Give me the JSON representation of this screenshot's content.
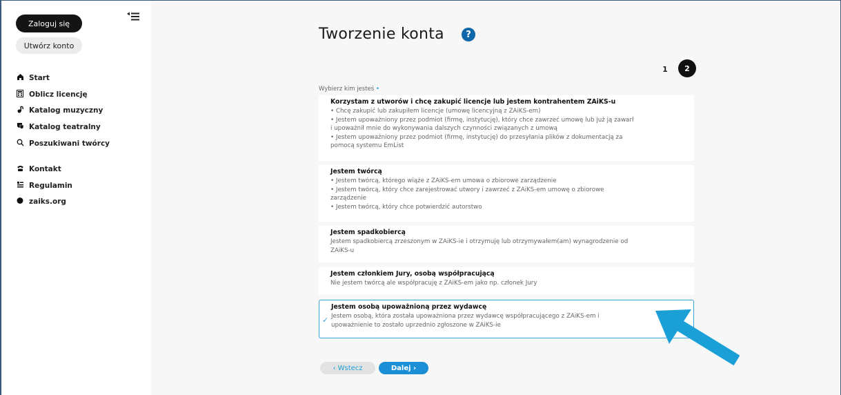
{
  "sidebar": {
    "login_label": "Zaloguj się",
    "register_label": "Utwórz konto",
    "collapse_icon": "collapse-sidebar-icon",
    "nav_primary": [
      {
        "label": "Start",
        "icon": "home-icon"
      },
      {
        "label": "Oblicz licencję",
        "icon": "calculator-icon"
      },
      {
        "label": "Katalog muzyczny",
        "icon": "music-icon"
      },
      {
        "label": "Katalog teatralny",
        "icon": "theater-icon"
      },
      {
        "label": "Poszukiwani twórcy",
        "icon": "search-icon"
      }
    ],
    "nav_secondary": [
      {
        "label": "Kontakt",
        "icon": "phone-icon"
      },
      {
        "label": "Regulamin",
        "icon": "document-icon"
      },
      {
        "label": "zaiks.org",
        "icon": "dot-icon"
      }
    ]
  },
  "page": {
    "title": "Tworzenie konta",
    "help_icon": "?",
    "steps": [
      "1",
      "2"
    ],
    "active_step": 2,
    "choose_label": "Wybierz kim jesteś",
    "required_marker": "•",
    "options": [
      {
        "title": "Korzystam z utworów i chcę zakupić licencje lub jestem kontrahentem ZAiKS-u",
        "lines": [
          "• Chcę zakupić lub zakupiłem licencje (umowę licencyjną z ZAiKS-em)",
          "• Jestem upoważniony przez podmiot (firmę, instytucję), który chce zawrzeć umowę lub już ją zawarł",
          "i upoważnił mnie do wykonywania dalszych czynności związanych z umową",
          "• Jestem upoważniony przez podmiot (firmę, instytucję) do przesyłania plików z dokumentacją za",
          "pomocą systemu EmList"
        ],
        "selected": false
      },
      {
        "title": "Jestem twórcą",
        "lines": [
          "• Jestem twórcą, którego wiąże z ZAiKS-em umowa o zbiorowe zarządzenie",
          "• Jestem twórcą, który chce zarejestrować utwory i zawrzeć z ZAiKS-em umowę o zbiorowe",
          "zarządzenie",
          "• Jestem twórcą, który chce potwierdzić autorstwo"
        ],
        "selected": false
      },
      {
        "title": "Jestem spadkobiercą",
        "lines": [
          "Jestem spadkobiercą zrzeszonym w ZAiKS-ie i otrzymuję lub otrzymywałem(am) wynagrodzenie od",
          "ZAiKS-u"
        ],
        "selected": false
      },
      {
        "title": "Jestem członkiem Jury, osobą współpracującą",
        "lines": [
          "Nie jestem twórcą ale współpracuję z ZAiKS-em jako np. członek Jury"
        ],
        "selected": false
      },
      {
        "title": "Jestem osobą upoważnioną przez wydawcę",
        "lines": [
          "Jestem osobą, która została upoważniona przez wydawcę współpracującego z ZAiKS-em i",
          "upoważnienie to zostało uprzednio zgłoszone w ZAiKS-ie"
        ],
        "selected": true
      }
    ],
    "back_label": "‹  Wstecz",
    "next_label": "Dalej  ›",
    "arrow_color": "#1a9fd6",
    "accent_color": "#1a8fd6"
  }
}
